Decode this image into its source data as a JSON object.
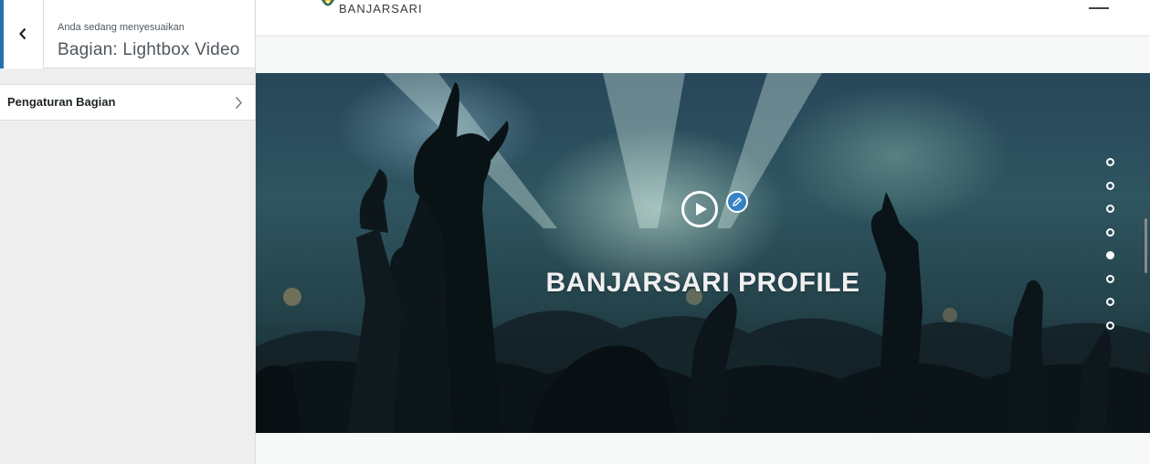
{
  "sidebar": {
    "action_text": "Anda sedang menyesuaikan",
    "section_title": "Bagian: Lightbox Video",
    "items": [
      {
        "label": "Pengaturan Bagian"
      }
    ]
  },
  "site": {
    "name": "BANJARSARI"
  },
  "hero": {
    "title": "BANJARSARI PROFILE",
    "slider": {
      "count": 8,
      "active_index": 4
    }
  },
  "colors": {
    "accent": "#2271b1",
    "edit_badge": "#3582c4"
  },
  "icons": {
    "back": "chevron-left-icon",
    "item_arrow": "chevron-right-icon",
    "play": "play-icon",
    "edit": "pencil-icon",
    "logo": "logo-icon",
    "menu": "hamburger-icon"
  }
}
